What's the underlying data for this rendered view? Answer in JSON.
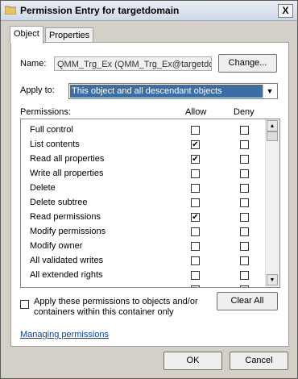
{
  "window": {
    "title": "Permission Entry for targetdomain",
    "close_glyph": "X"
  },
  "tabs": [
    {
      "label": "Object"
    },
    {
      "label": "Properties"
    }
  ],
  "name": {
    "label": "Name:",
    "value": "QMM_Trg_Ex (QMM_Trg_Ex@targetdo",
    "change_label": "Change..."
  },
  "apply": {
    "label": "Apply to:",
    "value": "This object and all descendant objects"
  },
  "permissions": {
    "header": "Permissions:",
    "allow_header": "Allow",
    "deny_header": "Deny",
    "rows": [
      {
        "name": "Full control",
        "allow": false,
        "deny": false
      },
      {
        "name": "List contents",
        "allow": true,
        "deny": false
      },
      {
        "name": "Read all properties",
        "allow": true,
        "deny": false
      },
      {
        "name": "Write all properties",
        "allow": false,
        "deny": false
      },
      {
        "name": "Delete",
        "allow": false,
        "deny": false
      },
      {
        "name": "Delete subtree",
        "allow": false,
        "deny": false
      },
      {
        "name": "Read permissions",
        "allow": true,
        "deny": false
      },
      {
        "name": "Modify permissions",
        "allow": false,
        "deny": false
      },
      {
        "name": "Modify owner",
        "allow": false,
        "deny": false
      },
      {
        "name": "All validated writes",
        "allow": false,
        "deny": false
      },
      {
        "name": "All extended rights",
        "allow": false,
        "deny": false
      },
      {
        "name": "",
        "allow": false,
        "deny": false
      }
    ]
  },
  "apply_children": {
    "label_line1": "Apply these permissions to objects and/or",
    "label_line2": "containers within this container only",
    "checked": false
  },
  "clear_all_label": "Clear All",
  "managing_link": "Managing permissions",
  "buttons": {
    "ok": "OK",
    "cancel": "Cancel"
  },
  "colors": {
    "selection": "#3a6ea5",
    "link": "#0645ad",
    "dialog_bg": "#d4d0c8"
  }
}
